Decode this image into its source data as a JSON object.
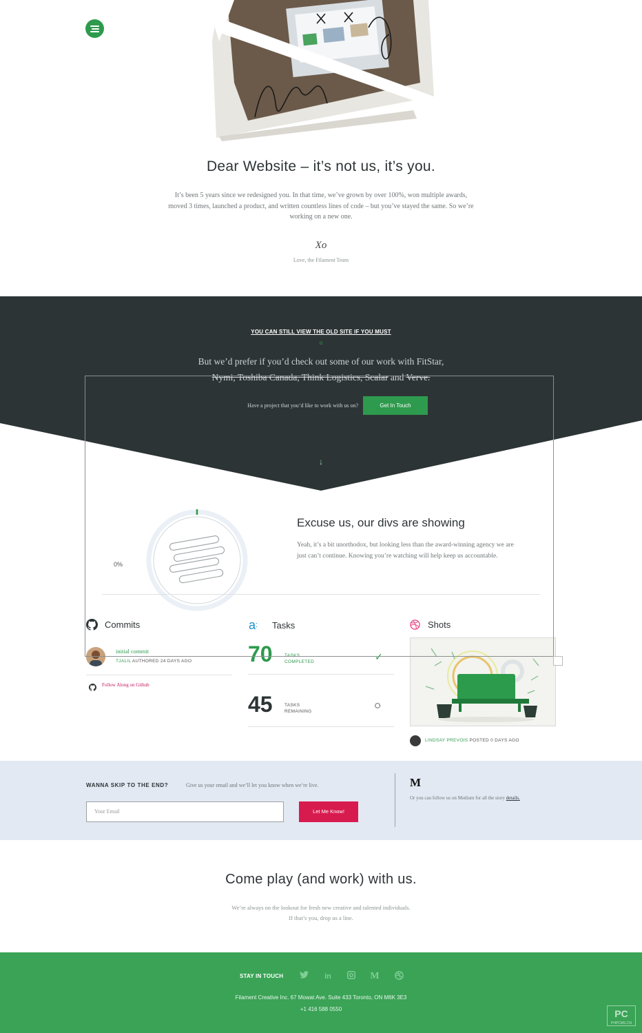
{
  "hero": {
    "title": "Dear Website – it’s not us, it’s you.",
    "body": "It’s been 5 years since we redesigned you. In that time, we’ve grown by over 100%, won multiple awards, moved 3 times, launched a product, and written countless lines of code – but you’ve stayed the same. So we’re working on a new one.",
    "xo": "Xo",
    "signature": "Love, the Filament Team"
  },
  "dark": {
    "old_site_link": "YOU CAN STILL VIEW THE OLD SITE IF YOU MUST",
    "old_site_dot": "o",
    "prefer_line1": "But we’d prefer if you’d check out some of our work with FitStar,",
    "prefer_clients": "Nymi, Toshiba Canada, Think Logistics, Scalar",
    "prefer_and": " and ",
    "prefer_last": "Verve.",
    "project_question": "Have a project that you’d like to work with us on?",
    "cta_label": "Get In Touch",
    "arrow": "↓"
  },
  "progress": {
    "percent_label": "0%",
    "percent_value": 0
  },
  "divs": {
    "title": "Excuse us, our divs are showing",
    "body": "Yeah, it’s a bit unorthodox, but looking less than the award-winning agency we are just can’t continue. Knowing you’re watching will help keep us accountable."
  },
  "commits": {
    "title": "Commits",
    "message": "initial commit",
    "author": "TJALIL",
    "meta_suffix": " AUTHORED 24 DAYS AGO",
    "follow": "Follow Along on Github"
  },
  "tasks": {
    "title": "Tasks",
    "completed_num": "70",
    "completed_top": "TASKS",
    "completed_bottom": "COMPLETED",
    "remaining_num": "45",
    "remaining_top": "TASKS",
    "remaining_bottom": "REMAINING",
    "check_glyph": "✓",
    "open_glyph": "○"
  },
  "shots": {
    "title": "Shots",
    "author": "LINDSAY PREVOIS",
    "meta_suffix": " POSTED 0 DAYS AGO"
  },
  "newsletter": {
    "heading": "WANNA SKIP TO THE END?",
    "sub": "Give us your email and we’ll let you know when we’re live.",
    "placeholder": "Your Email",
    "button": "Let Me Know!",
    "medium_logo": "M",
    "medium_text": "Or you can follow us on Medium for all the story ",
    "medium_link": "details."
  },
  "play": {
    "title": "Come play (and work) with us.",
    "line1": "We’re always on the lookout for fresh new creative and talented individuals.",
    "line2": "If that’s you, drop us a line."
  },
  "footer": {
    "stay": "STAY IN TOUCH",
    "address": "Filament Creative Inc. 67 Mowat Ave. Suite 433 Toronto, ON M6K 3E3",
    "phone": "+1 416 588 0550",
    "social": [
      {
        "name": "twitter-icon",
        "glyph": "🐦︎"
      },
      {
        "name": "linkedin-icon",
        "glyph": "in"
      },
      {
        "name": "instagram-icon",
        "glyph": "◙"
      },
      {
        "name": "medium-icon",
        "glyph": "M"
      },
      {
        "name": "dribbble-icon",
        "glyph": "◎"
      }
    ]
  },
  "watermark": {
    "big": "PC",
    "small": "PHPCMS.CN"
  },
  "colors": {
    "brand_green": "#2e9a4d",
    "dark_band": "#2d3436",
    "newsletter_bg": "#e3e9f2",
    "cta_pink": "#d81b4f",
    "footer_green": "#3aa356"
  }
}
